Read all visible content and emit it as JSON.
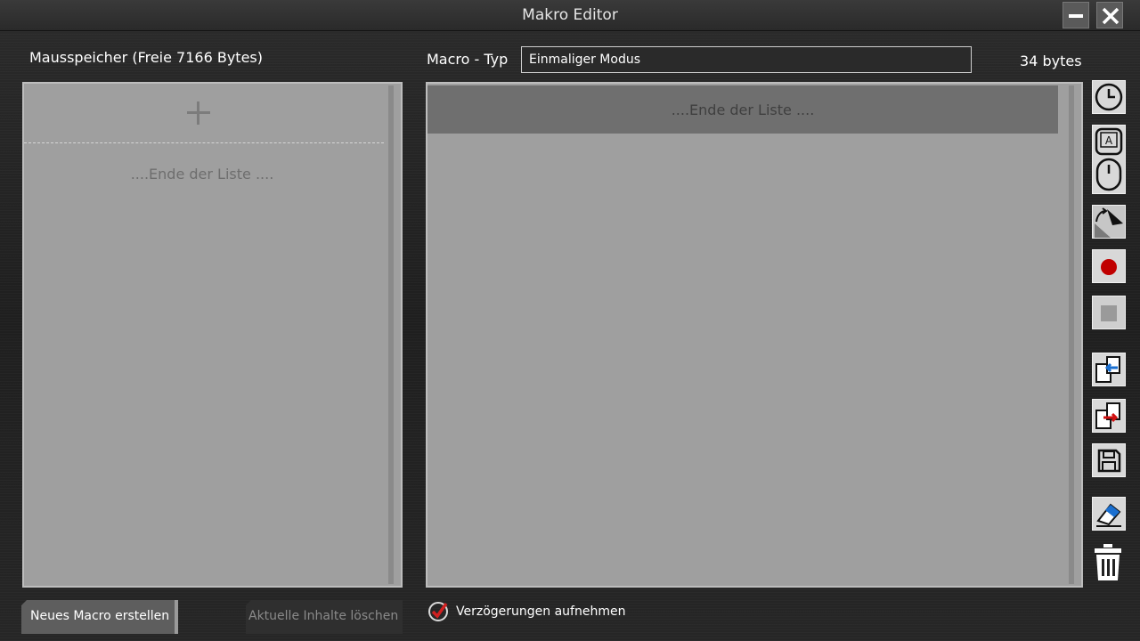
{
  "window": {
    "title": "Makro Editor"
  },
  "left_panel": {
    "title": "Mausspeicher (Freie 7166 Bytes)",
    "end_of_list": "....Ende der Liste ...."
  },
  "macro_type": {
    "label": "Macro - Typ",
    "value": "Einmaliger Modus"
  },
  "bytes": "34 bytes",
  "right_panel": {
    "end_of_list": "....Ende der Liste ...."
  },
  "buttons": {
    "new_macro": "Neues Macro erstellen",
    "clear_contents": "Aktuelle Inhalte löschen"
  },
  "record_delays": {
    "label": "Verzögerungen aufnehmen",
    "checked": true
  },
  "toolbar_icons": [
    "clock-icon",
    "keyboard-mouse-icon",
    "cursor-icon",
    "record-icon",
    "stop-icon",
    "import-icon",
    "export-icon",
    "save-icon",
    "eraser-icon",
    "trash-icon"
  ],
  "colors": {
    "record": "#c00000",
    "check": "#d02020"
  }
}
